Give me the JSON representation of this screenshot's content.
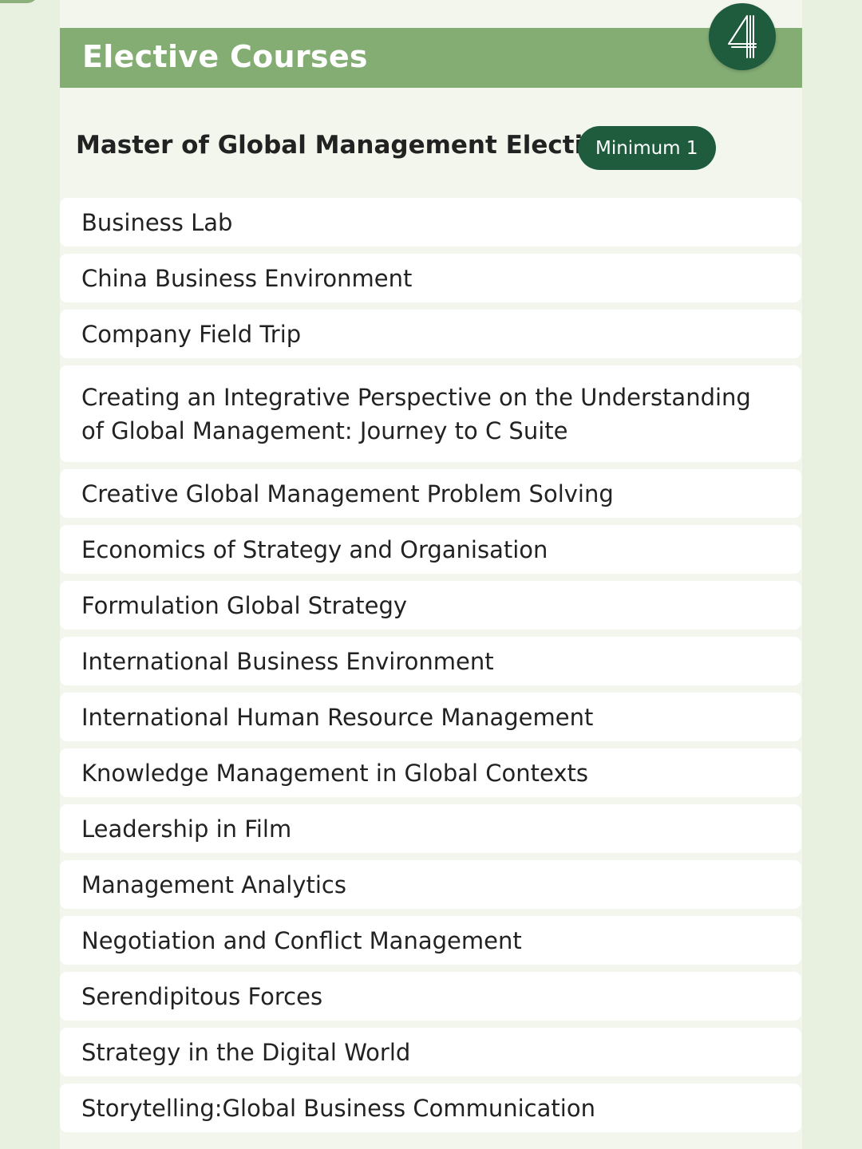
{
  "header": {
    "title": "Elective Courses",
    "step_number": "4"
  },
  "section": {
    "title": "Master of Global Management Electives",
    "requirement_badge": "Minimum 1"
  },
  "courses": [
    "Business Lab",
    "China Business Environment",
    "Company Field Trip",
    "Creating an Integrative Perspective on the Understanding of Global Management: Journey to C Suite",
    "Creative Global Management Problem Solving",
    "Economics of Strategy and Organisation",
    "Formulation Global Strategy",
    "International Business Environment",
    "International Human Resource Management",
    "Knowledge Management in Global Contexts",
    "Leadership in Film",
    "Management Analytics",
    "Negotiation and Conflict Management",
    "Serendipitous Forces",
    "Strategy in the Digital World",
    "Storytelling:Global Business Communication"
  ],
  "colors": {
    "page_background": "#e8f1df",
    "panel_background": "#f2f6ec",
    "header_green": "#84ad74",
    "dark_green": "#1f5c3e",
    "row_background": "#ffffff",
    "text": "#222222"
  }
}
